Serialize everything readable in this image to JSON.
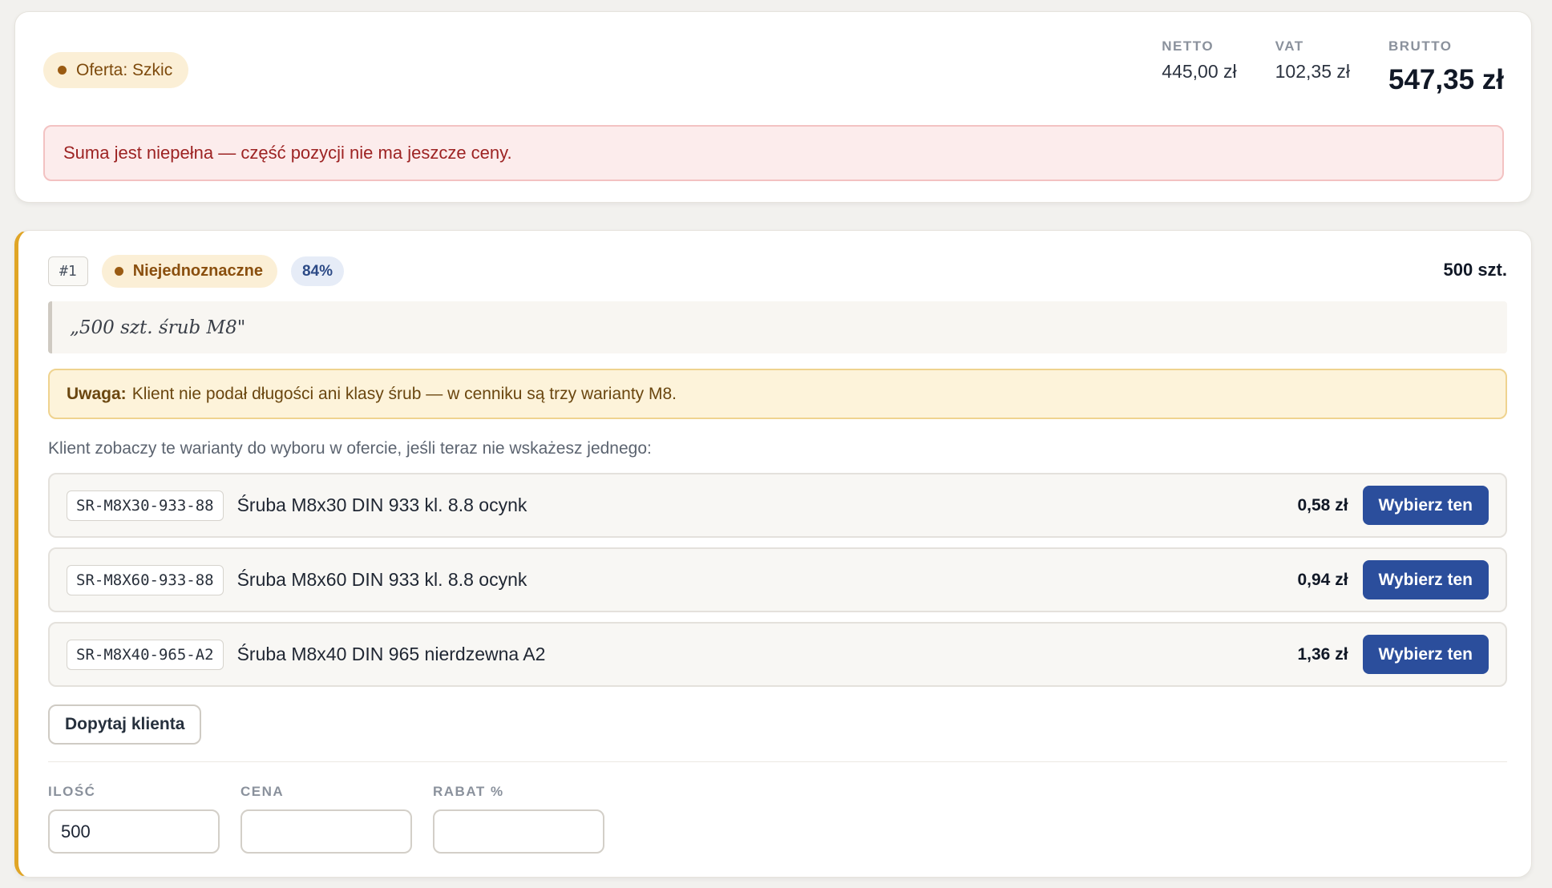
{
  "summary": {
    "status_label": "Oferta: Szkic",
    "netto_label": "NETTO",
    "netto_value": "445,00 zł",
    "vat_label": "VAT",
    "vat_value": "102,35 zł",
    "brutto_label": "BRUTTO",
    "brutto_value": "547,35 zł",
    "alert": "Suma jest niepełna — część pozycji nie ma jeszcze ceny."
  },
  "item": {
    "number": "#1",
    "status": "Niejednoznaczne",
    "confidence": "84%",
    "quantity_display": "500 szt.",
    "quote": "„500 szt. śrub M8\"",
    "warning_bold": "Uwaga:",
    "warning_text": "Klient nie podał długości ani klasy śrub — w cenniku są trzy warianty M8.",
    "hint": "Klient zobaczy te warianty do wyboru w ofercie, jeśli teraz nie wskażesz jednego:",
    "variants": [
      {
        "sku": "SR-M8X30-933-88",
        "name": "Śruba M8x30 DIN 933 kl. 8.8 ocynk",
        "price": "0,58 zł",
        "button": "Wybierz ten"
      },
      {
        "sku": "SR-M8X60-933-88",
        "name": "Śruba M8x60 DIN 933 kl. 8.8 ocynk",
        "price": "0,94 zł",
        "button": "Wybierz ten"
      },
      {
        "sku": "SR-M8X40-965-A2",
        "name": "Śruba M8x40 DIN 965 nierdzewna A2",
        "price": "1,36 zł",
        "button": "Wybierz ten"
      }
    ],
    "ask_button": "Dopytaj klienta",
    "fields": {
      "qty_label": "ILOŚĆ",
      "qty_value": "500",
      "price_label": "CENA",
      "price_value": "",
      "discount_label": "RABAT %",
      "discount_value": ""
    }
  },
  "colors": {
    "accent": "#2b4e9c",
    "warning_border": "#e0a526",
    "error_text": "#9d2323"
  }
}
